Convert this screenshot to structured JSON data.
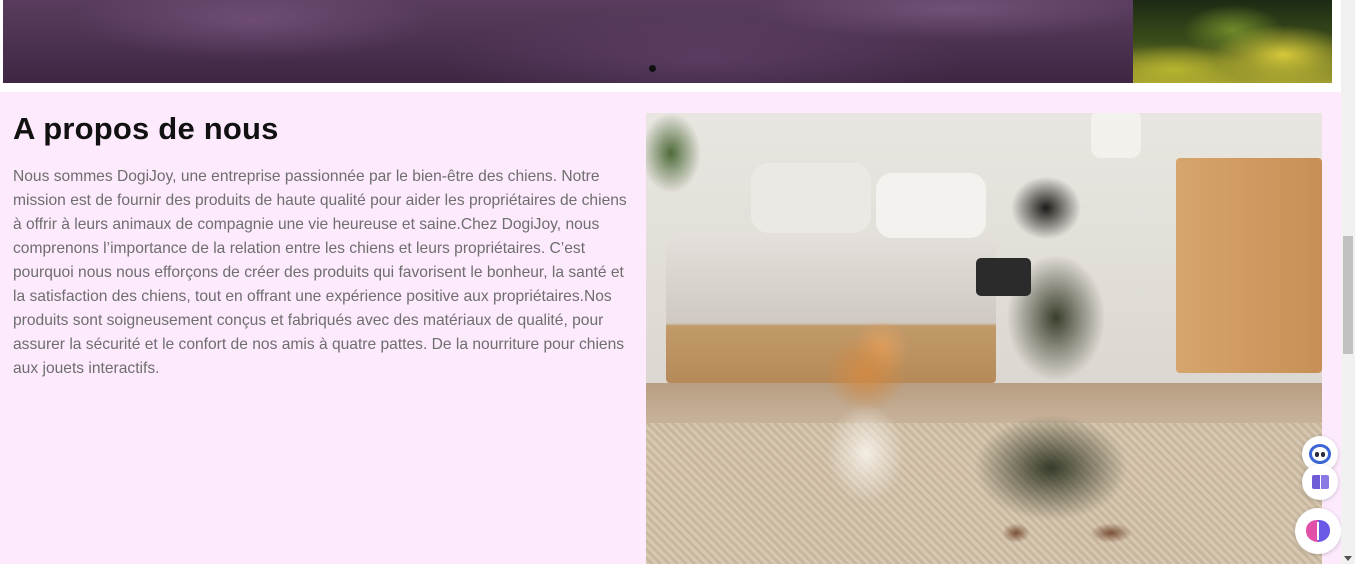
{
  "hero": {
    "carousel_indicator": "active"
  },
  "about": {
    "title": "A propos de nous",
    "text": "Nous sommes DogiJoy, une entreprise passionnée par le bien-être des chiens. Notre mission est de fournir des produits de haute qualité pour aider les propriétaires de chiens à offrir à leurs animaux de compagnie une vie heureuse et saine.Chez DogiJoy, nous comprenons l’importance de la relation entre les chiens et leurs propriétaires. C’est pourquoi nous nous efforçons de créer des produits qui favorisent le bonheur, la santé et la satisfaction des chiens, tout en offrant une expérience positive aux propriétaires.Nos produits sont soigneusement conçus et fabriqués avec des matériaux de qualité, pour assurer la sécurité et le confort de nos amis à quatre pattes. De la nourriture pour chiens aux jouets interactifs.",
    "background_color": "#fdeafd"
  },
  "floating_buttons": [
    {
      "icon": "chat-bot-icon"
    },
    {
      "icon": "book-icon"
    },
    {
      "icon": "brain-icon"
    }
  ]
}
